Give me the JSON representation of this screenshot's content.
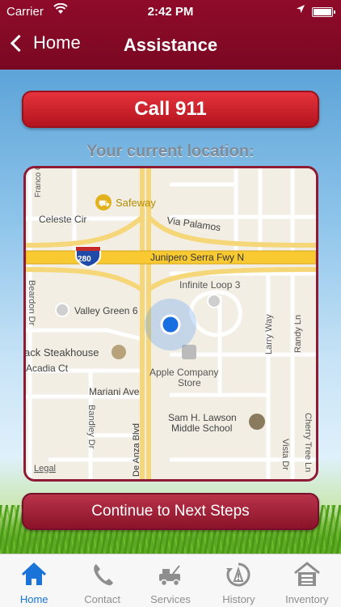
{
  "status_bar": {
    "carrier": "Carrier",
    "time": "2:42 PM",
    "battery_level": 1.0
  },
  "nav": {
    "back_label": "Home",
    "title": "Assistance"
  },
  "actions": {
    "call_label": "Call 911",
    "location_label": "Your current location:",
    "continue_label": "Continue to Next Steps"
  },
  "map": {
    "labels": {
      "franco": "Franco Ct",
      "safeway": "Safeway",
      "celeste": "Celeste Cir",
      "via_palamos": "Via Palamos",
      "interstate": "280",
      "freeway": "Junipero Serra Fwy N",
      "infinite_loop": "Infinite Loop 3",
      "beardon": "Beardon Dr",
      "valley_green": "Valley Green 6",
      "larry": "Larry Way",
      "randy": "Randy Ln",
      "steakhouse": "ack Steakhouse",
      "acadia": "Acadia Ct",
      "apple_line1": "Apple Company",
      "apple_line2": "Store",
      "mariani": "Mariani Ave",
      "bandley": "Bandley Dr",
      "de_anza": "N De Anza Blvd",
      "lawson_line1": "Sam H. Lawson",
      "lawson_line2": "Middle School",
      "vista": "Vista Dr",
      "cherry": "Cherry Tree Ln",
      "legal": "Legal"
    }
  },
  "tabs": [
    {
      "label": "Home",
      "icon": "home-icon",
      "active": true
    },
    {
      "label": "Contact",
      "icon": "phone-icon",
      "active": false
    },
    {
      "label": "Services",
      "icon": "tow-truck-icon",
      "active": false
    },
    {
      "label": "History",
      "icon": "history-icon",
      "active": false
    },
    {
      "label": "Inventory",
      "icon": "inventory-icon",
      "active": false
    }
  ],
  "colors": {
    "brand_red": "#8f0b2a",
    "call_red": "#d4222c",
    "tab_active": "#1a73d9",
    "location_dot": "#1a6fe0"
  }
}
